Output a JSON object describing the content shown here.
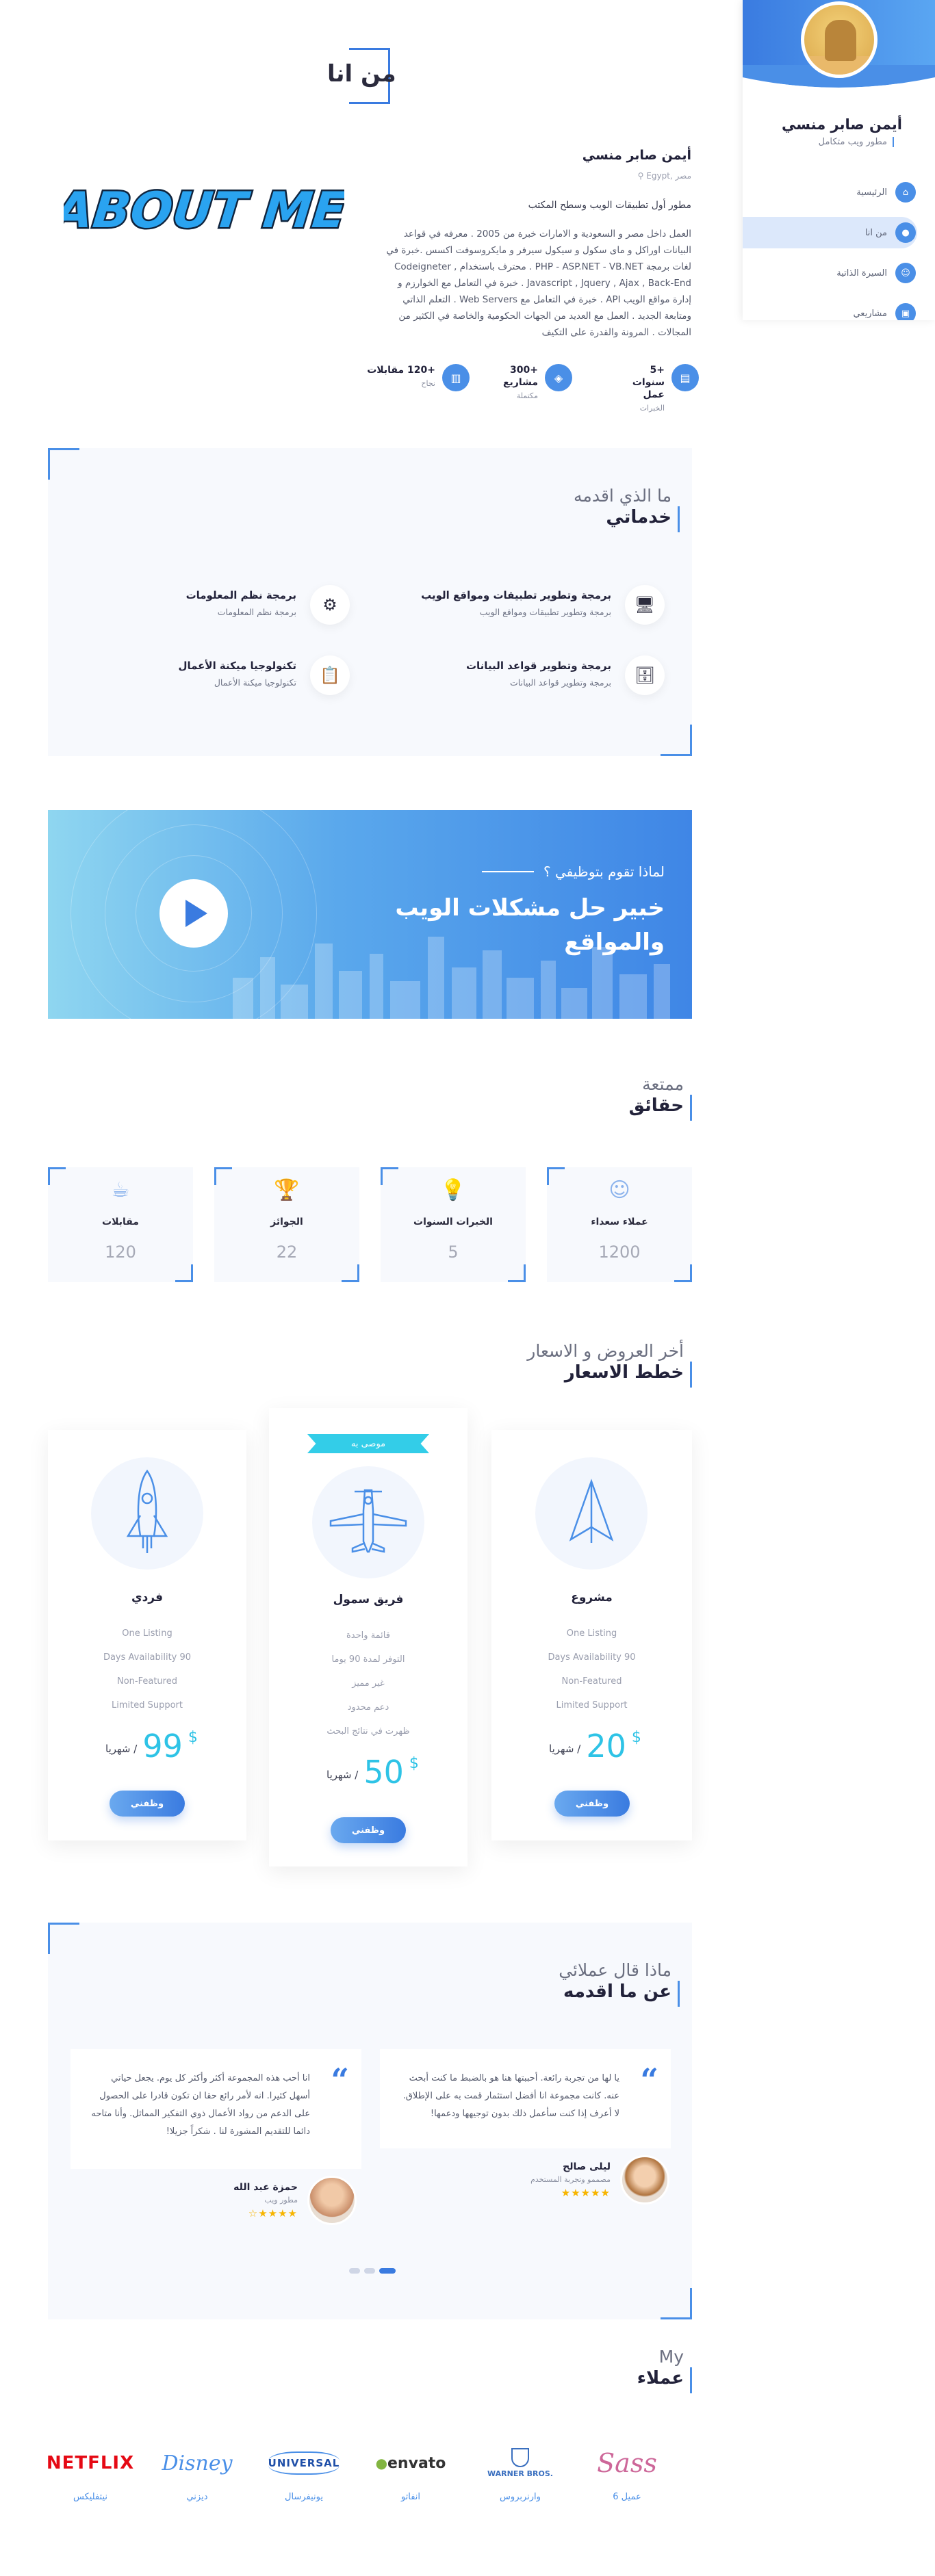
{
  "sidebar": {
    "name": "أيمن صابر منسي",
    "role": "مطور ويب متكامل",
    "items": [
      {
        "label": "الرئيسية",
        "icon": "home-icon",
        "glyph": "⌂"
      },
      {
        "label": "من انا",
        "icon": "user-icon",
        "glyph": "👤"
      },
      {
        "label": "السيرة الذاتية",
        "icon": "person-icon",
        "glyph": "☺"
      },
      {
        "label": "مشاريعي",
        "icon": "briefcase-icon",
        "glyph": "▣"
      }
    ]
  },
  "about": {
    "title": "من انا",
    "logo_text": "ABOUT ME",
    "name": "أيمن صابر منسي",
    "location": "مصر ,Egypt",
    "role": "مطور أول تطبيقات الويب وسطح المكتب",
    "description": "العمل داخل مصر و السعودية و الامارات خبرة من 2005 . معرفه في قواعد البيانات اوراكل و ماى سكول و سيكول سيرفر و مايكروسوفت اكسس .خبرة في لغات برمجة PHP - ASP.NET - VB.NET . محترف باستخدام Codeigneter , Javascript , Jquery , Ajax , Back-End . خبرة في التعامل مع الخوارزم و إدارة مواقع الويب API . خبرة في التعامل مع Web Servers . التعلم الذاتي ومتابعة الجديد . العمل مع العديد من الجهات الحكومية والخاصة في الكثير من المجالات . المرونة والقدرة على التكيف",
    "stats": [
      {
        "value": "+5 سنوات عمل",
        "label": "الخبرات",
        "icon": "briefcase-icon",
        "glyph": "▤"
      },
      {
        "value": "+300 مشاريع",
        "label": "مكتملة",
        "icon": "layers-icon",
        "glyph": "◈"
      },
      {
        "value": "+120 مقابلات",
        "label": "نجاح",
        "icon": "trash-icon",
        "glyph": "▥"
      }
    ]
  },
  "services": {
    "subtitle": "ما الذي اقدمه",
    "title": "خدماتي",
    "items": [
      {
        "title": "برمجة وتطوير تطبيقات ومواقع الويب",
        "desc": "برمجة وتطوير تطبيقات ومواقع الويب",
        "icon": "web-app-icon",
        "glyph": "🖥"
      },
      {
        "title": "برمجة نظم المعلومات",
        "desc": "برمجة نظم المعلومات",
        "icon": "info-systems-icon",
        "glyph": "⚙"
      },
      {
        "title": "برمجة وتطوير قواعد البيانات",
        "desc": "برمجة وتطوير قواعد البيانات",
        "icon": "database-icon",
        "glyph": "🗄"
      },
      {
        "title": "تكنولوجيا ميكنة الأعمال",
        "desc": "تكنولوجيا ميكنة الأعمال",
        "icon": "automation-icon",
        "glyph": "📋"
      }
    ]
  },
  "banner": {
    "subtitle": "لماذا تقوم بتوظيفي ؟",
    "title": "خبير حل مشكلات الويب والمواقع"
  },
  "facts": {
    "subtitle": "ممتعة",
    "title": "حقائق",
    "items": [
      {
        "label": "مقابلات",
        "value": "120",
        "icon": "coffee-icon",
        "glyph": "☕"
      },
      {
        "label": "الجوائز",
        "value": "22",
        "icon": "trophy-icon",
        "glyph": "🏆"
      },
      {
        "label": "الخبرات السنوات",
        "value": "5",
        "icon": "bulb-icon",
        "glyph": "💡"
      },
      {
        "label": "عملاء سعداء",
        "value": "1200",
        "icon": "smile-icon",
        "glyph": "☺"
      }
    ]
  },
  "pricing": {
    "subtitle": "أخر العروض و الاسعار",
    "title": "خطط الاسعار",
    "plans": [
      {
        "name": "فردي",
        "features": [
          "One Listing",
          "Days Availability 90",
          "Non-Featured",
          "Limited Support"
        ],
        "price": "99",
        "currency": "$",
        "period": "/ شهريا",
        "button": "وظفني",
        "icon": "rocket-icon"
      },
      {
        "name": "فريق سمول",
        "ribbon": "موصى به",
        "features": [
          "قائمة واحدة",
          "التوفر لمدة 90 يوما",
          "غير مميز",
          "دعم محدود",
          "ظهرت في نتائج البحث"
        ],
        "price": "50",
        "currency": "$",
        "period": "/ شهريا",
        "button": "وظفني",
        "icon": "plane-icon"
      },
      {
        "name": "مشروع",
        "features": [
          "One Listing",
          "Days Availability 90",
          "Non-Featured",
          "Limited Support"
        ],
        "price": "20",
        "currency": "$",
        "period": "/ شهريا",
        "button": "وظفني",
        "icon": "paper-plane-icon"
      }
    ]
  },
  "testimonials": {
    "subtitle": "ماذا قال عملائي",
    "title": "عن ما اقدمه",
    "items": [
      {
        "text": "انا أحب هذه المجموعة أكثر وأكثر كل يوم. يجعل حياتي أسهل كثيرا. انه لأمر رائع حقا ان تكون قادرا على الحصول على الدعم من رواد الأعمال ذوي التفكير المماثل. وأنا متاحه دائما للتقديم المشورة لنا . شكراً جزيلا!",
        "name": "حمزة عبد الله",
        "role": "مطور ويب",
        "stars": "★★★★☆"
      },
      {
        "text": "يا لها من تجربة رائعة. أحببتها هنا هو بالضبط ما كنت أبحث عنه. كانت مجموعة انا أفضل استثمار قمت به على الإطلاق. لا أعرف إذا كنت سأعمل ذلك بدون توجيهها ودعمها!",
        "name": "ليلى صالح",
        "role": "مصممو وتجربة المستخدم",
        "stars": "★★★★★"
      }
    ]
  },
  "clients": {
    "subtitle": "My",
    "title": "عملاء",
    "items": [
      {
        "name": "نيتفليكس",
        "logo": "NETFLIX",
        "icon": "netflix-logo"
      },
      {
        "name": "ديزني",
        "logo": "Disney",
        "icon": "disney-logo"
      },
      {
        "name": "يونيفرسال",
        "logo": "UNIVERSAL",
        "icon": "universal-logo"
      },
      {
        "name": "انفاتو",
        "logo": "envato",
        "icon": "envato-logo"
      },
      {
        "name": "وارنربروس",
        "logo": "WARNER BROS.",
        "icon": "warner-logo"
      },
      {
        "name": "عميل 6",
        "logo": "Sass",
        "icon": "sass-logo"
      }
    ]
  },
  "colors": {
    "accent": "#4a8fe7",
    "accent_dark": "#3a7be0",
    "price": "#2ec3e6",
    "panel": "#f7f9fd"
  }
}
